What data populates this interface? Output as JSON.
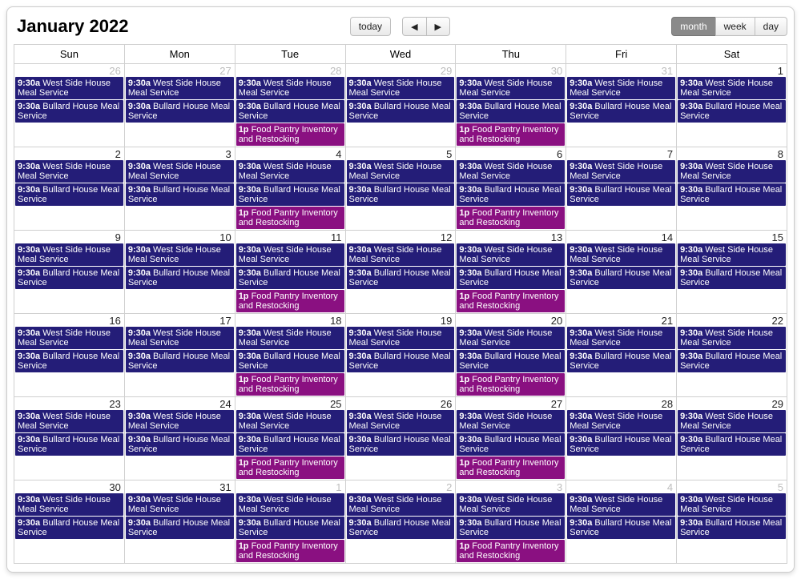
{
  "title": "January 2022",
  "buttons": {
    "today": "today",
    "prev": "◀",
    "next": "▶",
    "month": "month",
    "week": "week",
    "day": "day"
  },
  "dayHeaders": [
    "Sun",
    "Mon",
    "Tue",
    "Wed",
    "Thu",
    "Fri",
    "Sat"
  ],
  "eventTemplates": {
    "west": {
      "time": "9:30a",
      "title": "West Side House Meal Service",
      "color": "blue"
    },
    "bullard": {
      "time": "9:30a",
      "title": "Bullard House Meal Service",
      "color": "blue"
    },
    "pantry": {
      "time": "1p",
      "title": "Food Pantry Inventory and Restocking",
      "color": "purple"
    }
  },
  "weeks": [
    [
      {
        "n": 26,
        "other": true,
        "ev": [
          "west",
          "bullard"
        ]
      },
      {
        "n": 27,
        "other": true,
        "ev": [
          "west",
          "bullard"
        ]
      },
      {
        "n": 28,
        "other": true,
        "ev": [
          "west",
          "bullard",
          "pantry"
        ]
      },
      {
        "n": 29,
        "other": true,
        "ev": [
          "west",
          "bullard"
        ]
      },
      {
        "n": 30,
        "other": true,
        "ev": [
          "west",
          "bullard",
          "pantry"
        ]
      },
      {
        "n": 31,
        "other": true,
        "ev": [
          "west",
          "bullard"
        ]
      },
      {
        "n": 1,
        "ev": [
          "west",
          "bullard"
        ]
      }
    ],
    [
      {
        "n": 2,
        "ev": [
          "west",
          "bullard"
        ]
      },
      {
        "n": 3,
        "ev": [
          "west",
          "bullard"
        ]
      },
      {
        "n": 4,
        "ev": [
          "west",
          "bullard",
          "pantry"
        ]
      },
      {
        "n": 5,
        "ev": [
          "west",
          "bullard"
        ]
      },
      {
        "n": 6,
        "ev": [
          "west",
          "bullard",
          "pantry"
        ]
      },
      {
        "n": 7,
        "ev": [
          "west",
          "bullard"
        ]
      },
      {
        "n": 8,
        "ev": [
          "west",
          "bullard"
        ]
      }
    ],
    [
      {
        "n": 9,
        "ev": [
          "west",
          "bullard"
        ]
      },
      {
        "n": 10,
        "ev": [
          "west",
          "bullard"
        ]
      },
      {
        "n": 11,
        "ev": [
          "west",
          "bullard",
          "pantry"
        ]
      },
      {
        "n": 12,
        "ev": [
          "west",
          "bullard"
        ]
      },
      {
        "n": 13,
        "ev": [
          "west",
          "bullard",
          "pantry"
        ]
      },
      {
        "n": 14,
        "ev": [
          "west",
          "bullard"
        ]
      },
      {
        "n": 15,
        "ev": [
          "west",
          "bullard"
        ]
      }
    ],
    [
      {
        "n": 16,
        "ev": [
          "west",
          "bullard"
        ]
      },
      {
        "n": 17,
        "ev": [
          "west",
          "bullard"
        ]
      },
      {
        "n": 18,
        "ev": [
          "west",
          "bullard",
          "pantry"
        ]
      },
      {
        "n": 19,
        "ev": [
          "west",
          "bullard"
        ]
      },
      {
        "n": 20,
        "ev": [
          "west",
          "bullard",
          "pantry"
        ]
      },
      {
        "n": 21,
        "ev": [
          "west",
          "bullard"
        ]
      },
      {
        "n": 22,
        "ev": [
          "west",
          "bullard"
        ]
      }
    ],
    [
      {
        "n": 23,
        "ev": [
          "west",
          "bullard"
        ]
      },
      {
        "n": 24,
        "ev": [
          "west",
          "bullard"
        ]
      },
      {
        "n": 25,
        "ev": [
          "west",
          "bullard",
          "pantry"
        ]
      },
      {
        "n": 26,
        "ev": [
          "west",
          "bullard"
        ]
      },
      {
        "n": 27,
        "ev": [
          "west",
          "bullard",
          "pantry"
        ]
      },
      {
        "n": 28,
        "ev": [
          "west",
          "bullard"
        ]
      },
      {
        "n": 29,
        "ev": [
          "west",
          "bullard"
        ]
      }
    ],
    [
      {
        "n": 30,
        "ev": [
          "west",
          "bullard"
        ]
      },
      {
        "n": 31,
        "ev": [
          "west",
          "bullard"
        ]
      },
      {
        "n": 1,
        "other": true,
        "ev": [
          "west",
          "bullard",
          "pantry"
        ]
      },
      {
        "n": 2,
        "other": true,
        "ev": [
          "west",
          "bullard"
        ]
      },
      {
        "n": 3,
        "other": true,
        "ev": [
          "west",
          "bullard",
          "pantry"
        ]
      },
      {
        "n": 4,
        "other": true,
        "ev": [
          "west",
          "bullard"
        ]
      },
      {
        "n": 5,
        "other": true,
        "ev": [
          "west",
          "bullard"
        ]
      }
    ]
  ]
}
